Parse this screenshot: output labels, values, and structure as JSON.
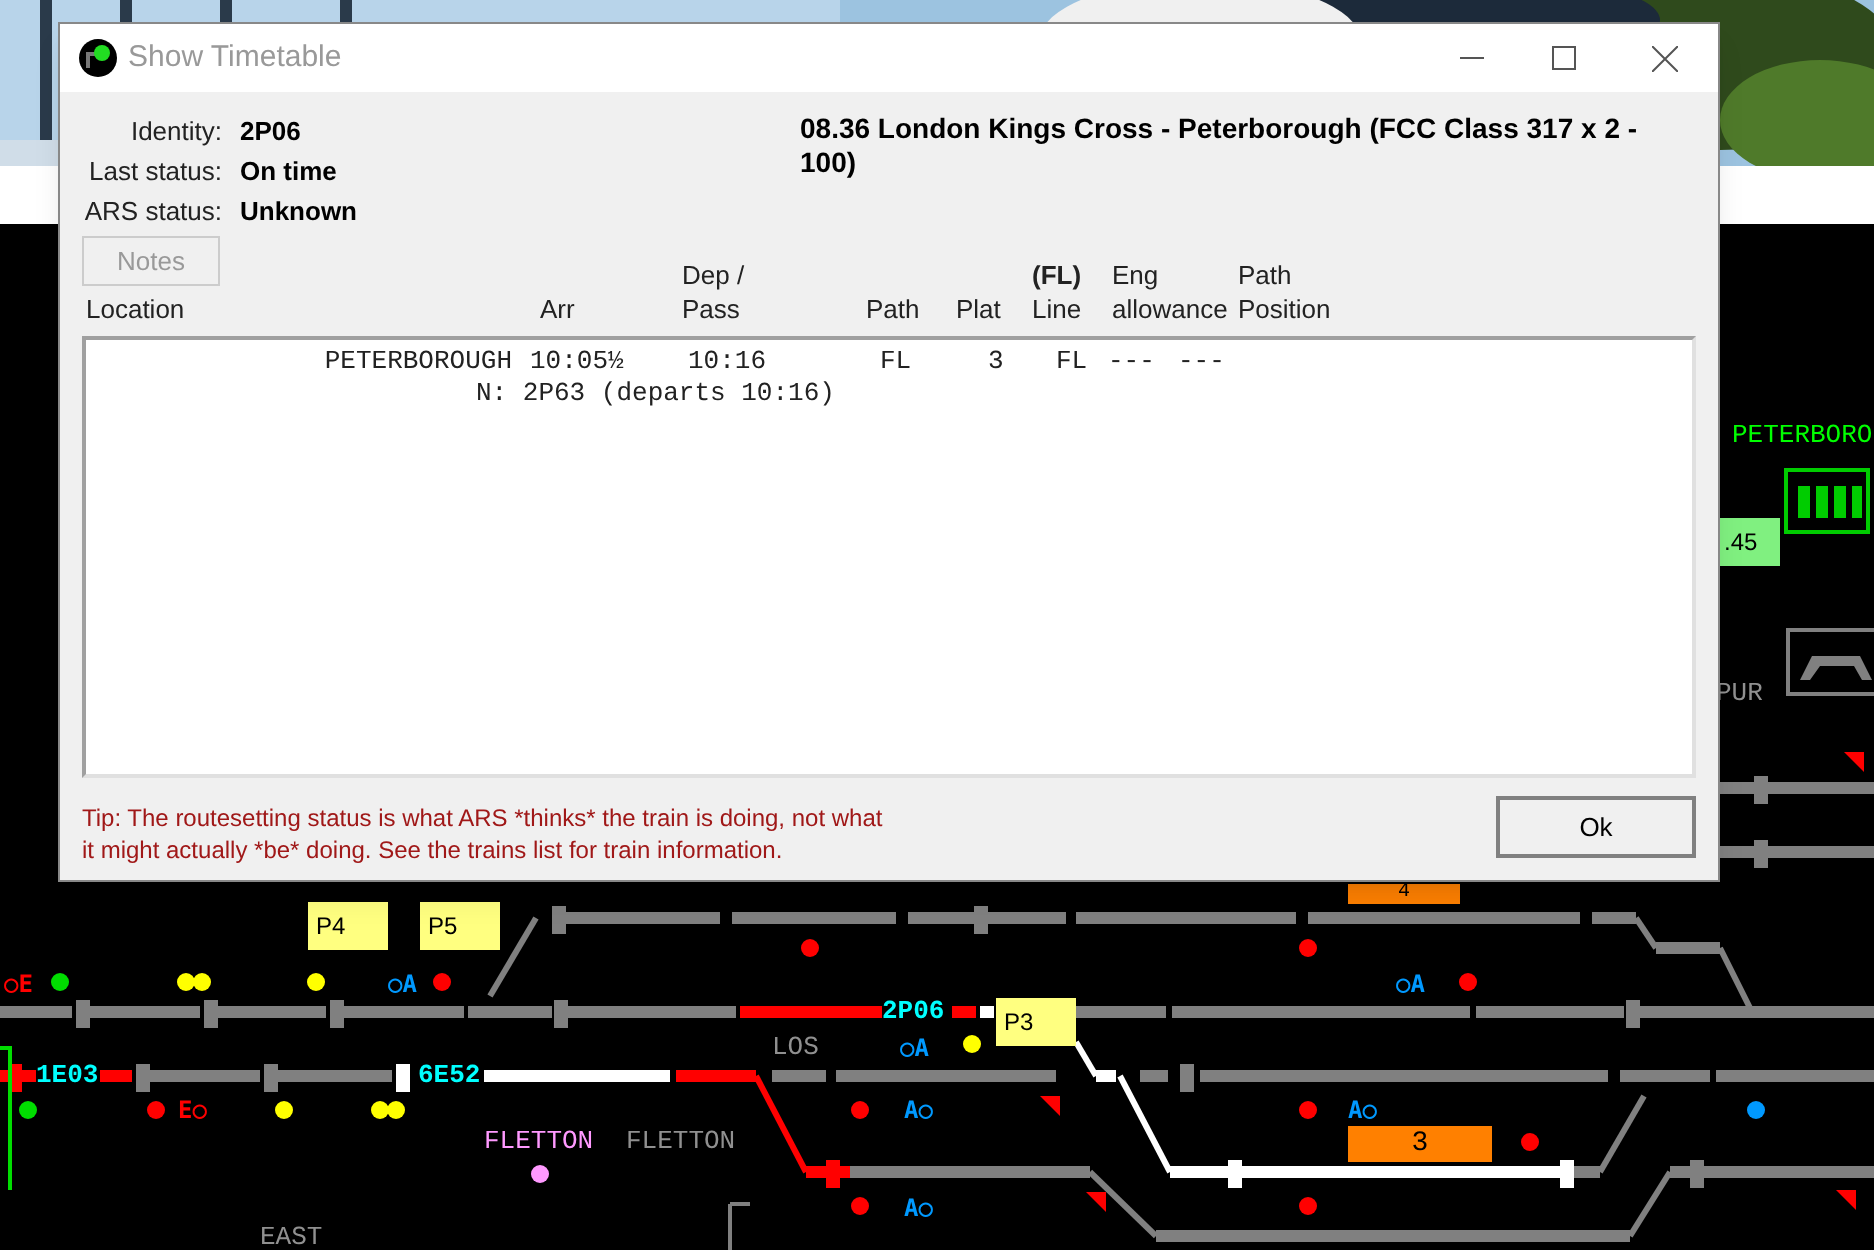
{
  "window": {
    "title": "Show Timetable"
  },
  "details": [
    {
      "label": "Identity:",
      "value": "2P06"
    },
    {
      "label": "Last status:",
      "value": "On time"
    },
    {
      "label": "ARS status:",
      "value": "Unknown"
    }
  ],
  "description": "08.36 London Kings Cross - Peterborough (FCC Class 317 x 2 - 100)",
  "notes_button": {
    "label": "Notes",
    "disabled": true
  },
  "columns": [
    {
      "lines": [
        "Location"
      ]
    },
    {
      "lines": [
        "Arr"
      ]
    },
    {
      "lines": [
        "Dep /",
        "Pass"
      ]
    },
    {
      "lines": [
        "Path"
      ]
    },
    {
      "lines": [
        "Plat"
      ]
    },
    {
      "lines": [
        "**(FL)**",
        "Line"
      ]
    },
    {
      "lines": [
        "Eng",
        "allowance"
      ]
    },
    {
      "lines": [
        "Path",
        "Position"
      ]
    }
  ],
  "rows": [
    {
      "kind": "stop",
      "cells": [
        "PETERBOROUGH",
        "10:05½",
        "10:16",
        "FL",
        "3",
        "FL",
        "---",
        "---"
      ]
    },
    {
      "kind": "note",
      "text": "N: 2P63 (departs 10:16)"
    }
  ],
  "tip": [
    "Tip: The routesetting status is what ARS *thinks* the train is doing, not what",
    "it might actually *be* doing. See the trains list for train information."
  ],
  "ok_button": "Ok",
  "diagram": {
    "labels": [
      {
        "kind": "station",
        "text": "PETERBORO",
        "color": "#00ff00"
      },
      {
        "kind": "readout",
        "text": ".45"
      },
      {
        "kind": "station",
        "text": "PUR",
        "color": "#909090"
      },
      {
        "kind": "berth",
        "text": "4"
      },
      {
        "kind": "platform",
        "text": "P4"
      },
      {
        "kind": "platform",
        "text": "P5"
      },
      {
        "kind": "signal",
        "text": "○E",
        "color": "#ff0000"
      },
      {
        "kind": "signal",
        "text": "○A",
        "color": "#0099ff"
      },
      {
        "kind": "signal",
        "text": "○A",
        "color": "#0099ff"
      },
      {
        "kind": "train",
        "text": "2P06"
      },
      {
        "kind": "platform",
        "text": "P3"
      },
      {
        "kind": "station",
        "text": "LOS",
        "color": "#909090"
      },
      {
        "kind": "signal",
        "text": "○A",
        "color": "#0099ff"
      },
      {
        "kind": "train",
        "text": "1E03"
      },
      {
        "kind": "train",
        "text": "6E52"
      },
      {
        "kind": "signal",
        "text": "E○",
        "color": "#ff0000"
      },
      {
        "kind": "signal",
        "text": "A○",
        "color": "#0099ff"
      },
      {
        "kind": "signal",
        "text": "A○",
        "color": "#0099ff"
      },
      {
        "kind": "station",
        "text": "FLETTON",
        "color": "#ff99ff"
      },
      {
        "kind": "station",
        "text": "FLETTON",
        "color": "#909090"
      },
      {
        "kind": "berth",
        "text": "3"
      },
      {
        "kind": "signal",
        "text": "A○",
        "color": "#0099ff"
      },
      {
        "kind": "station",
        "text": "EAST",
        "color": "#909090"
      }
    ]
  }
}
